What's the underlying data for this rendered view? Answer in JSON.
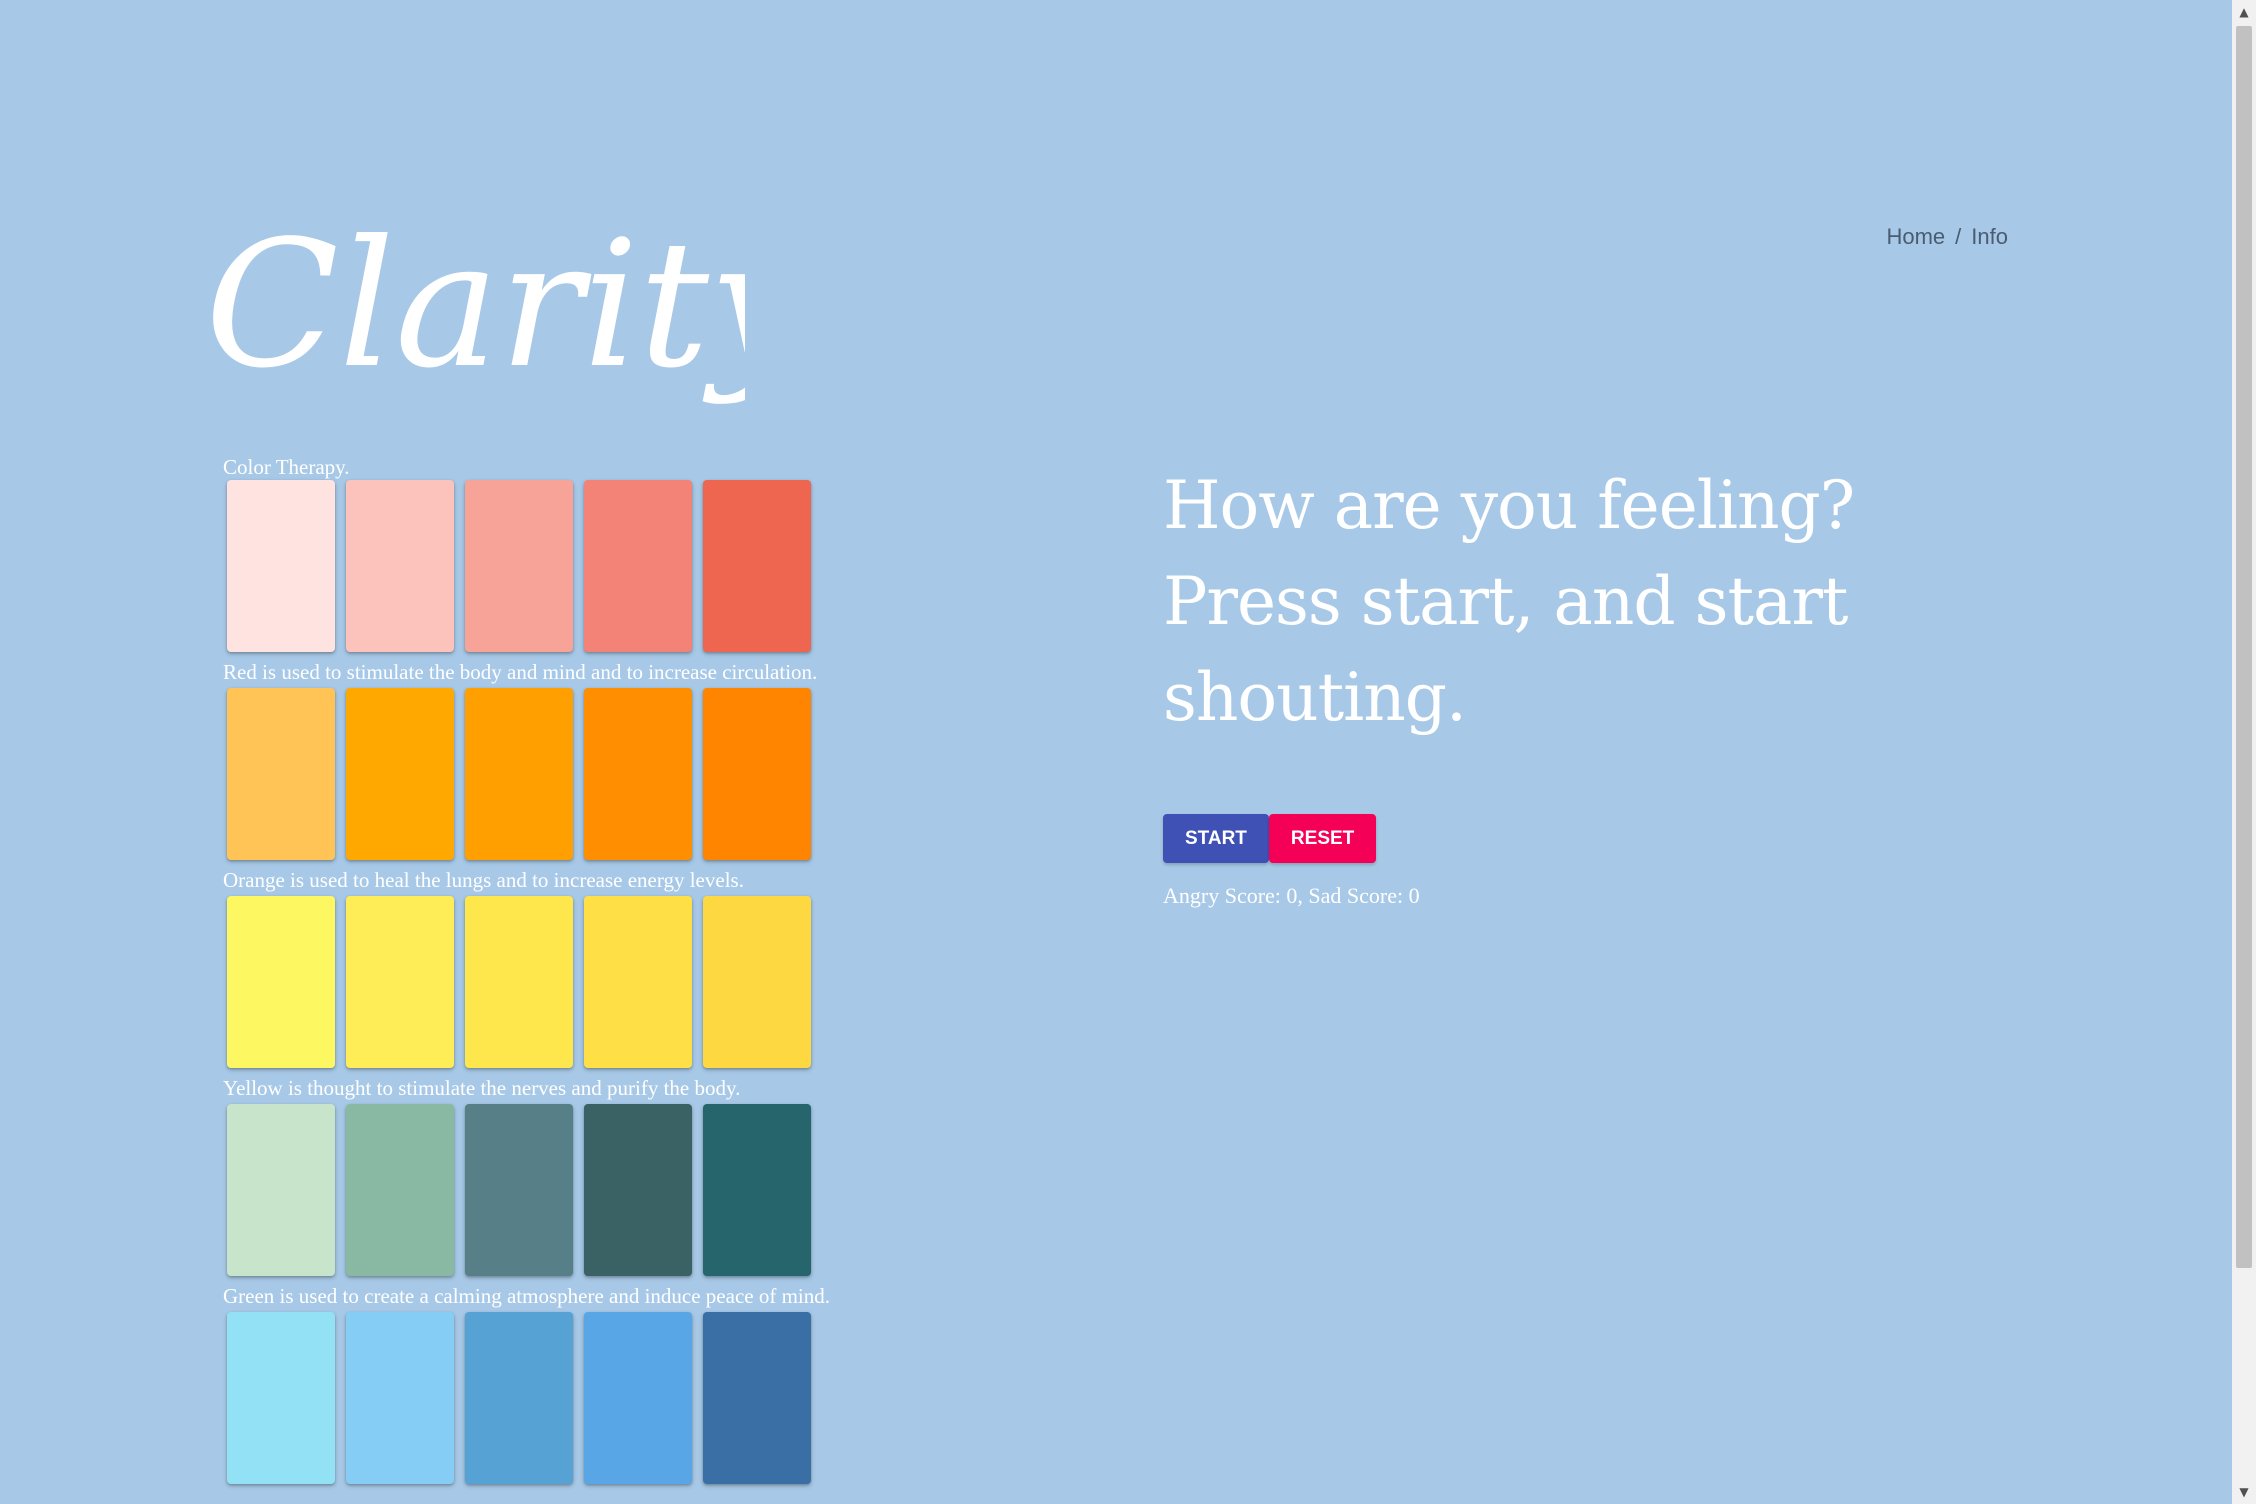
{
  "logo": {
    "text": "Clarity"
  },
  "nav": {
    "home": "Home",
    "separator": "/",
    "info": "Info"
  },
  "section_title": "Color Therapy.",
  "palettes": [
    {
      "colors": [
        "#ffe3e0",
        "#fcc2bc",
        "#f8a398",
        "#f28376",
        "#ee6650"
      ],
      "description": "Red is used to stimulate the body and mind and to increase circulation."
    },
    {
      "colors": [
        "#ffc455",
        "#ffa900",
        "#ff9f00",
        "#ff8f00",
        "#ff8400"
      ],
      "description": "Orange is used to heal the lungs and to increase energy levels."
    },
    {
      "colors": [
        "#fdf761",
        "#feed57",
        "#fee64d",
        "#fee046",
        "#fdd840"
      ],
      "description": "Yellow is thought to stimulate the nerves and purify the body."
    },
    {
      "colors": [
        "#c8e4cb",
        "#89b9a2",
        "#577f88",
        "#3a6163",
        "#26656c"
      ],
      "description": "Green is used to create a calming atmosphere and induce peace of mind."
    },
    {
      "colors": [
        "#93e1f5",
        "#85cdf4",
        "#57a2d5",
        "#58a6e6",
        "#3a6fa6"
      ],
      "description": ""
    }
  ],
  "headline": "How are you feeling? Press start, and start shouting.",
  "buttons": {
    "start": "START",
    "reset": "RESET"
  },
  "score": "Angry Score: 0, Sad Score: 0",
  "colors": {
    "background": "#a7c9e7",
    "start_button": "#3f51b5",
    "reset_button": "#f50057"
  },
  "icons": {
    "scroll_up": "triangle-up",
    "scroll_down": "triangle-down"
  }
}
